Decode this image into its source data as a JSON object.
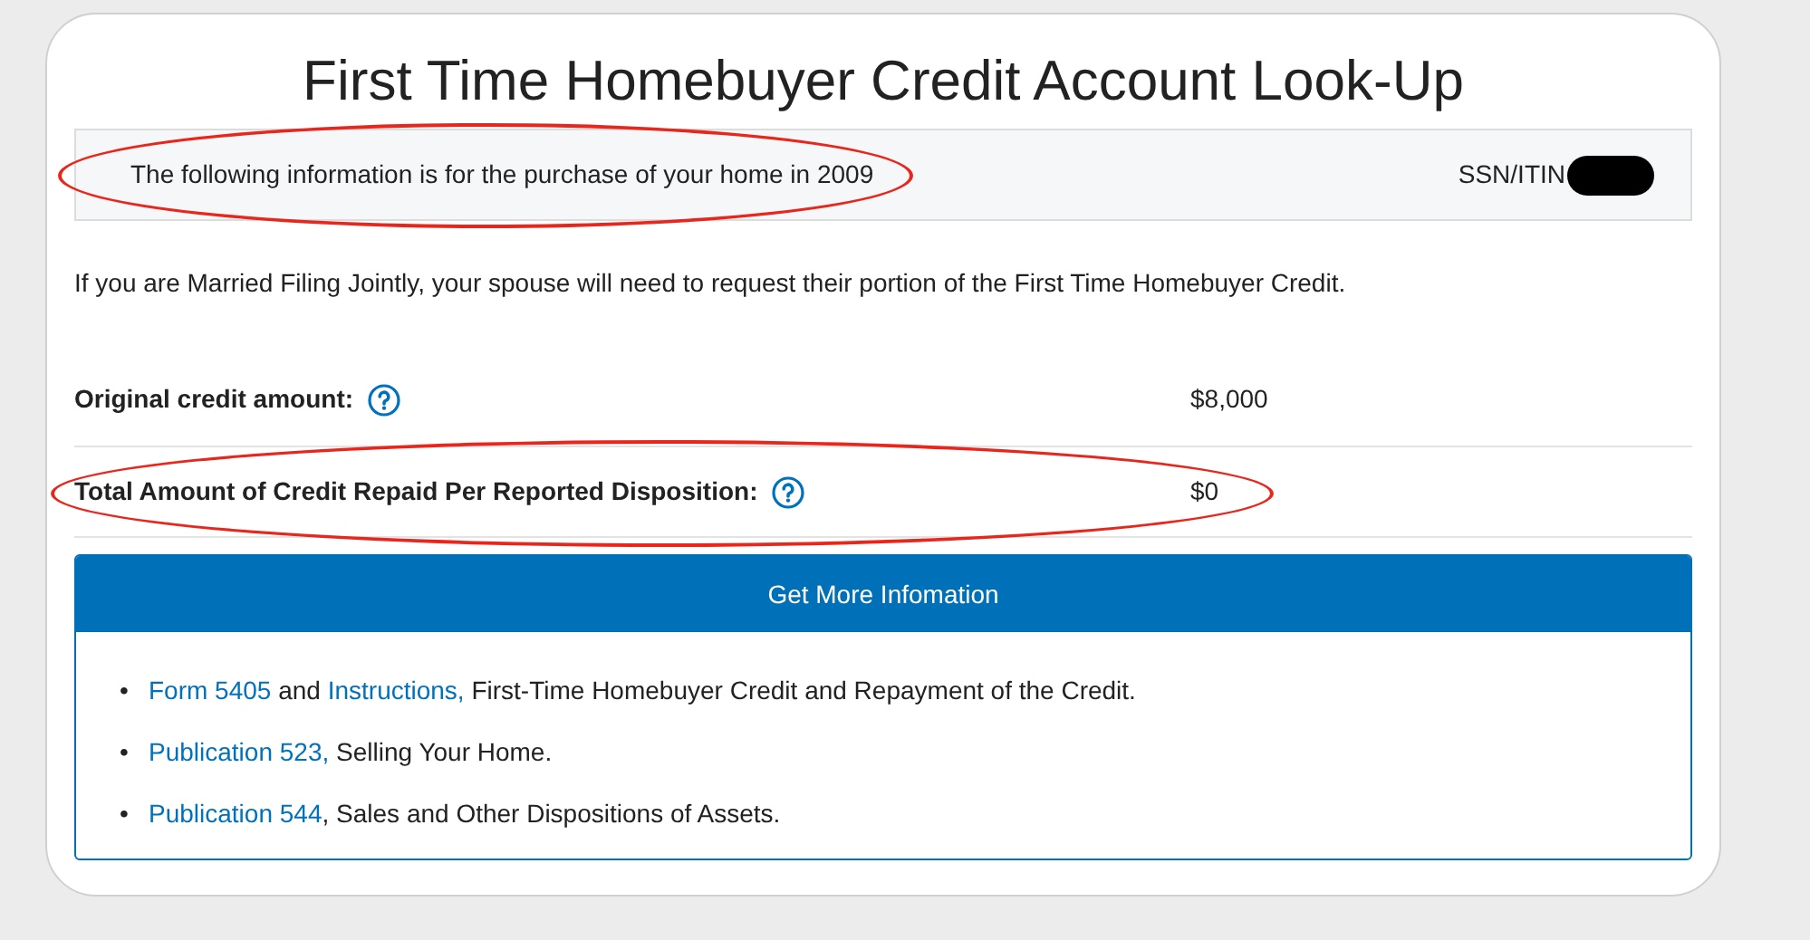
{
  "title": "First Time Homebuyer Credit Account Look-Up",
  "info_bar": {
    "text": "The following information is for the purchase of your home in 2009",
    "circled": true,
    "id_label": "SSN/ITIN",
    "id_redacted": true
  },
  "note": "If you are Married Filing Jointly, your spouse will need to request their portion of the First Time Homebuyer Credit.",
  "rows": [
    {
      "label": "Original credit amount:",
      "value": "$8,000",
      "circled": false
    },
    {
      "label": "Total Amount of Credit Repaid Per Reported Disposition:",
      "value": "$0",
      "circled": true
    }
  ],
  "panel": {
    "title": "Get More Infomation",
    "items": [
      {
        "bullet": "•",
        "segments": [
          {
            "kind": "link",
            "text": "Form 5405"
          },
          {
            "kind": "text",
            "text": " and "
          },
          {
            "kind": "link",
            "text": "Instructions,"
          },
          {
            "kind": "text",
            "text": " First-Time Homebuyer Credit and Repayment of the Credit."
          }
        ]
      },
      {
        "bullet": "•",
        "segments": [
          {
            "kind": "link",
            "text": "Publication 523,"
          },
          {
            "kind": "text",
            "text": " Selling Your Home."
          }
        ]
      },
      {
        "bullet": "•",
        "segments": [
          {
            "kind": "link",
            "text": "Publication 544"
          },
          {
            "kind": "text",
            "text": ", Sales and Other Dispositions of Assets."
          }
        ]
      }
    ]
  }
}
